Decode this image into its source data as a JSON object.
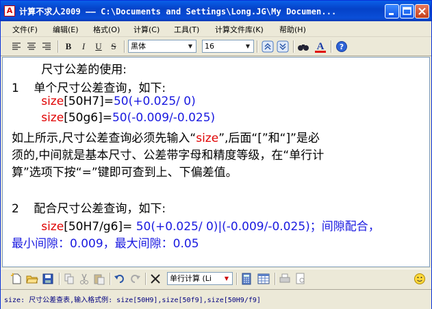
{
  "window": {
    "title": "计算不求人2009 —— C:\\Documents and Settings\\Long.JG\\My Documen...",
    "icon_letter": "A"
  },
  "menu": [
    "文件(F)",
    "编辑(E)",
    "格式(O)",
    "计算(C)",
    "工具(T)",
    "计算文件库(K)",
    "帮助(H)"
  ],
  "format_toolbar": {
    "font_name": "黑体",
    "font_size": "16",
    "bold": "B",
    "italic": "I",
    "underline": "U",
    "strike": "S",
    "color_letter": "A"
  },
  "editor": {
    "lines": [
      {
        "prefix": "",
        "parts": [
          {
            "t": "        尺寸公差的使用:",
            "c": "black"
          }
        ]
      },
      {
        "parts": [
          {
            "t": "1    单个尺寸公差查询，如下:",
            "c": "black"
          }
        ]
      },
      {
        "parts": [
          {
            "t": "        size",
            "c": "red"
          },
          {
            "t": "[50H7]=",
            "c": "black"
          },
          {
            "t": "50(+0.025/ 0)",
            "c": "blue"
          }
        ]
      },
      {
        "parts": [
          {
            "t": "        size",
            "c": "red"
          },
          {
            "t": "[50g6]=",
            "c": "black"
          },
          {
            "t": "50(-0.009/-0.025)",
            "c": "blue"
          }
        ]
      },
      {
        "parts": [
          {
            "t": "如上所示,尺寸公差查询必须先输入“",
            "c": "black"
          },
          {
            "t": "size",
            "c": "red"
          },
          {
            "t": "”,后面“[”和“]”是必",
            "c": "black"
          }
        ]
      },
      {
        "parts": [
          {
            "t": "须的,中间就是基本尺寸、公差带字母和精度等级，在“单行计",
            "c": "black"
          }
        ]
      },
      {
        "parts": [
          {
            "t": "算”选项下按“=”键即可查到上、下偏差值。",
            "c": "black"
          }
        ]
      },
      {
        "parts": [
          {
            "t": "",
            "c": "black"
          }
        ]
      },
      {
        "parts": [
          {
            "t": "2    配合尺寸公差查询，如下:",
            "c": "black"
          }
        ]
      },
      {
        "parts": [
          {
            "t": "        size",
            "c": "red"
          },
          {
            "t": "[50H7/g6]= ",
            "c": "black"
          },
          {
            "t": "50(+0.025/ 0)|(-0.009/-0.025)；间隙配合，",
            "c": "blue"
          }
        ]
      },
      {
        "parts": [
          {
            "t": "最小间隙：0.009，最大间隙：0.05",
            "c": "blue"
          }
        ]
      }
    ]
  },
  "calc_toolbar": {
    "mode_combo": "单行计算 (Li"
  },
  "status": {
    "text": "size: 尺寸公差查表,输入格式例: size[50H9],size[50f9],size[50H9/f9]"
  }
}
